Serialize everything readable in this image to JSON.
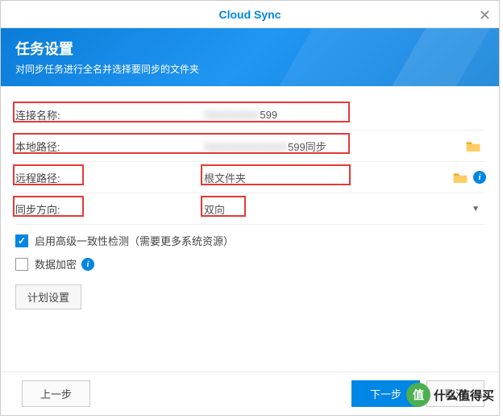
{
  "header": {
    "title": "Cloud Sync",
    "close": "✕"
  },
  "banner": {
    "title": "任务设置",
    "subtitle": "对同步任务进行全名并选择要同步的文件夹"
  },
  "form": {
    "conn_label": "连接名称:",
    "conn_value": "599",
    "local_label": "本地路径:",
    "local_value": "599同步",
    "remote_label": "远程路径:",
    "remote_value": "根文件夹",
    "dir_label": "同步方向:",
    "dir_value": "双向"
  },
  "checks": {
    "adv_label": "启用高级一致性检测（需要更多系统资源）",
    "enc_label": "数据加密"
  },
  "buttons": {
    "schedule": "计划设置",
    "back": "上一步",
    "next": "下一步",
    "cancel": "取消"
  },
  "watermark": {
    "circle": "值",
    "text": "什么值得买"
  }
}
